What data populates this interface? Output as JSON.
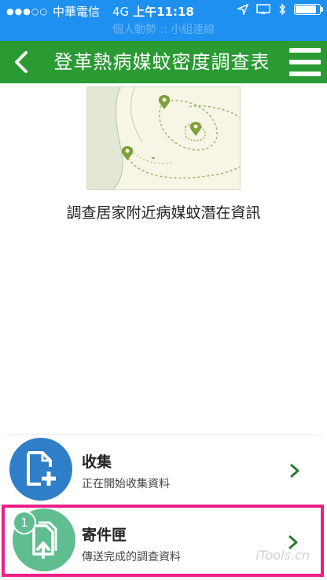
{
  "status_bar": {
    "carrier": "中華電信",
    "network": "4G",
    "time": "上午11:18",
    "subtitle": "個人動勢 :: 小組連線",
    "icons": [
      "signal-dots-icon",
      "location-arrow-icon",
      "screen-mirror-icon",
      "bluetooth-icon",
      "battery-icon"
    ]
  },
  "header": {
    "title": "登革熱病媒蚊密度調查表",
    "back_icon": "chevron-left-icon",
    "menu_icon": "hamburger-menu-icon",
    "color": "#2a9a33"
  },
  "main": {
    "map_icon": "map-pins-illustration",
    "description": "調查居家附近病媒蚊潛在資訊"
  },
  "cards": [
    {
      "title": "收集",
      "subtitle": "正在開始收集資料",
      "icon": "add-document-icon",
      "circle_color": "#2f7fc8"
    },
    {
      "title": "寄件匣",
      "subtitle": "傳送完成的調查資料",
      "icon": "upload-documents-icon",
      "badge": "1",
      "circle_color": "#5fbd8f",
      "highlight_color": "#ea1f86"
    }
  ],
  "watermark": "iTools.cn"
}
